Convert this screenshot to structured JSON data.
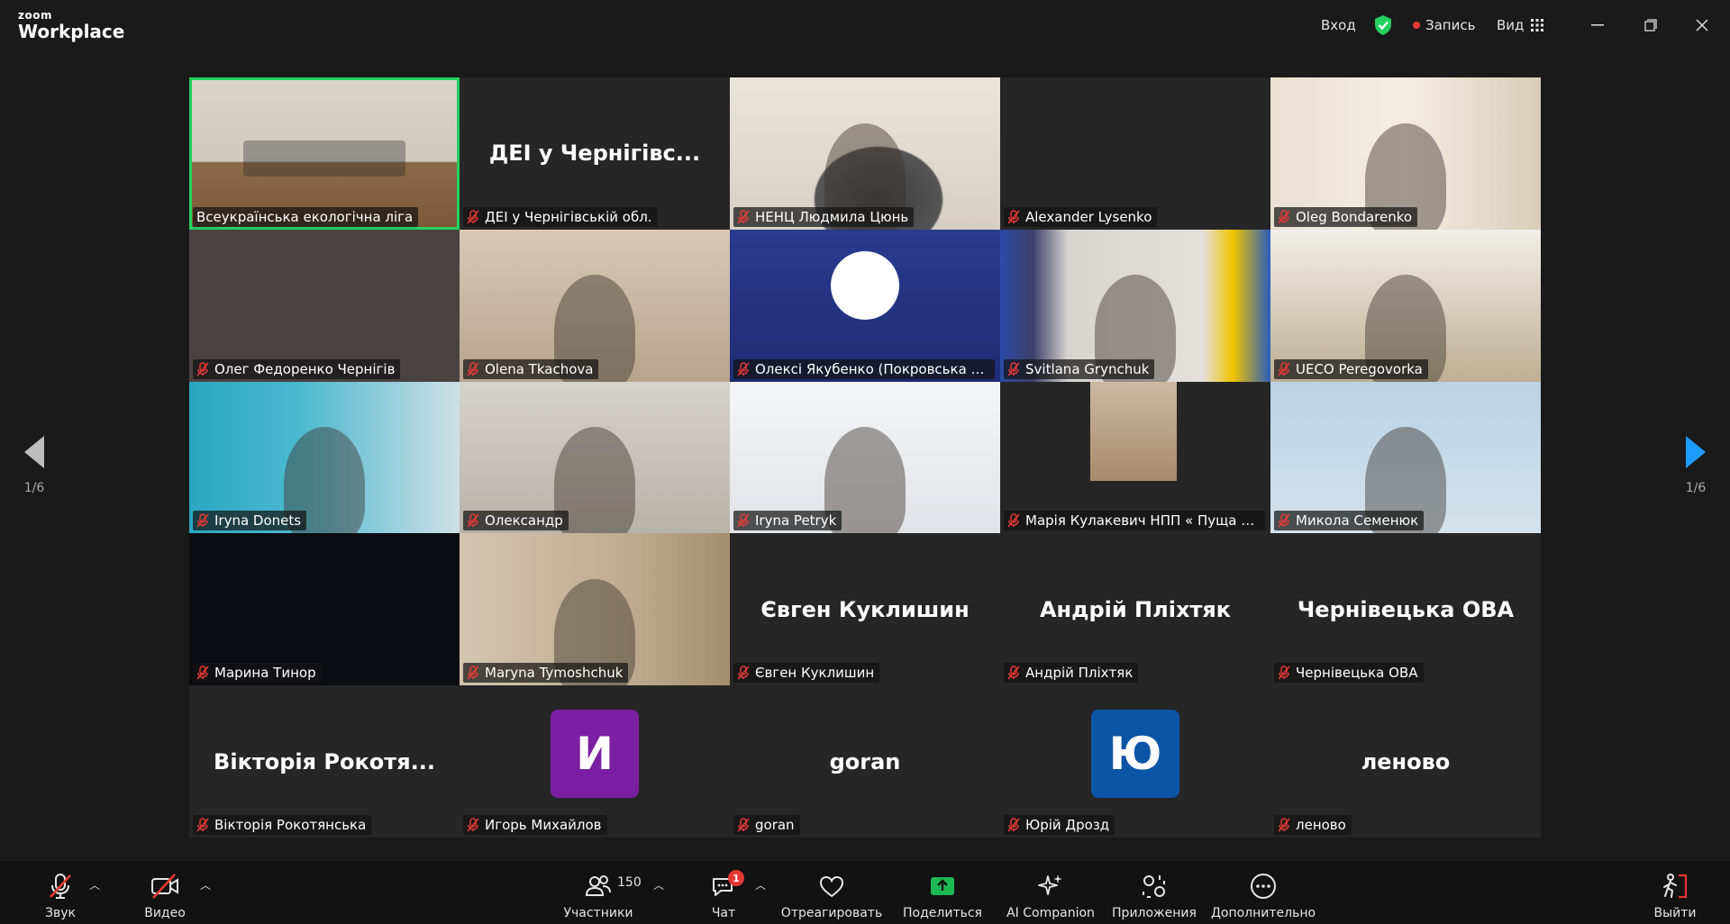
{
  "app": {
    "logo_small": "zoom",
    "logo_big": "Workplace"
  },
  "titlebar": {
    "login": "Вход",
    "record": "Запись",
    "view": "Вид"
  },
  "tiles": [
    {
      "name": "Всеукраїнська екологічна ліга",
      "muted": false,
      "bg": "v-conf",
      "active": true
    },
    {
      "name": "ДЕІ у Чернігівській обл.",
      "big": "ДЕІ у Чернігівс...",
      "muted": true
    },
    {
      "name": "НЕНЦ Людмила Цюнь",
      "muted": true,
      "bg": "v-sofa"
    },
    {
      "name": "Alexander Lysenko",
      "muted": true
    },
    {
      "name": "Oleg Bondarenko",
      "muted": true,
      "bg": "v-office"
    },
    {
      "name": "Олег Федоренко Чернігів",
      "muted": true,
      "bg": "v-wall"
    },
    {
      "name": "Olena Tkachova",
      "muted": true,
      "bg": "v-woman1"
    },
    {
      "name": "Олексі Якубенко (Покровська сели...",
      "muted": true,
      "bg": "v-obs"
    },
    {
      "name": "Svitlana Grynchuk",
      "muted": true,
      "bg": "v-flags"
    },
    {
      "name": "UECO Peregovorka",
      "muted": true,
      "bg": "v-room"
    },
    {
      "name": "Iryna Donets",
      "muted": true,
      "bg": "v-teal"
    },
    {
      "name": "Олександр",
      "muted": true,
      "bg": "v-man2"
    },
    {
      "name": "Iryna Petryk",
      "muted": true,
      "bg": "v-uni"
    },
    {
      "name": "Марія Кулакевич НПП « Пуща Радзі...",
      "muted": true,
      "bg": "v-girl"
    },
    {
      "name": "Микола Семенюк",
      "muted": true,
      "bg": "v-man3"
    },
    {
      "name": "Марина Тинор",
      "muted": true,
      "bg": "v-black"
    },
    {
      "name": "Maryna Tymoshchuk",
      "muted": true,
      "bg": "v-wood"
    },
    {
      "name": "Євген Куклишин",
      "big": "Євген Куклишин",
      "muted": true
    },
    {
      "name": "Андрій Пліхтяк",
      "big": "Андрій Пліхтяк",
      "muted": true
    },
    {
      "name": "Чернівецька ОВА",
      "big": "Чернівецька ОВА",
      "muted": true
    },
    {
      "name": "Вікторія Рокотянська",
      "big": "Вікторія Рокотя...",
      "muted": true
    },
    {
      "name": "Игорь Михайлов",
      "avatar": "И",
      "avatar_color": "#7b1fa2",
      "muted": true
    },
    {
      "name": "goran",
      "big": "goran",
      "muted": true
    },
    {
      "name": "Юрій Дрозд",
      "avatar": "Ю",
      "avatar_color": "#0b55a6",
      "muted": true
    },
    {
      "name": "леново",
      "big": "леново",
      "muted": true
    }
  ],
  "pager": {
    "left": "1/6",
    "right": "1/6"
  },
  "toolbar": {
    "audio": "Звук",
    "video": "Видео",
    "participants": "Участники",
    "participants_count": "150",
    "chat": "Чат",
    "chat_badge": "1",
    "react": "Отреагировать",
    "share": "Поделиться",
    "ai": "AI Companion",
    "apps": "Приложения",
    "more": "Дополнительно",
    "leave": "Выйти"
  },
  "colors": {
    "accent_green": "#23d160",
    "share_green": "#1db954",
    "mute_red": "#e53935",
    "nav_blue": "#1e9bff"
  }
}
